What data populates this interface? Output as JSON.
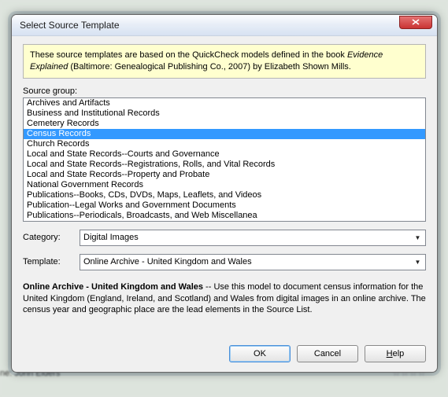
{
  "window": {
    "title": "Select Source Template"
  },
  "info": {
    "pre": "These source templates are based on the QuickCheck models defined in the book",
    "book": "Evidence Explained",
    "post": "(Baltimore: Genealogical Publishing Co., 2007) by Elizabeth Shown Mills."
  },
  "source_group": {
    "label": "Source group:",
    "items": [
      "Archives and Artifacts",
      "Business and Institutional Records",
      "Cemetery Records",
      "Census Records",
      "Church Records",
      "Local and State Records--Courts and Governance",
      "Local and State Records--Registrations, Rolls, and Vital Records",
      "Local and State Records--Property and Probate",
      "National Government Records",
      "Publications--Books, CDs, DVDs, Maps, Leaflets, and Videos",
      "Publication--Legal Works and Government Documents",
      "Publications--Periodicals, Broadcasts, and Web Miscellanea"
    ],
    "selected_index": 3
  },
  "category": {
    "label": "Category:",
    "value": "Digital Images"
  },
  "template": {
    "label": "Template:",
    "value": "Online Archive - United Kingdom and Wales"
  },
  "description": {
    "title": "Online Archive - United Kingdom and Wales",
    "text": " -- Use this model to document census information for the United Kingdom (England, Ireland, and Scotland) and Wales from digital images in an online archive. The census year and geographic place are the lead elements in the Source List."
  },
  "buttons": {
    "ok": "OK",
    "cancel": "Cancel",
    "help": "Help"
  },
  "backdrop": {
    "name_label": "ne: John Elders"
  }
}
